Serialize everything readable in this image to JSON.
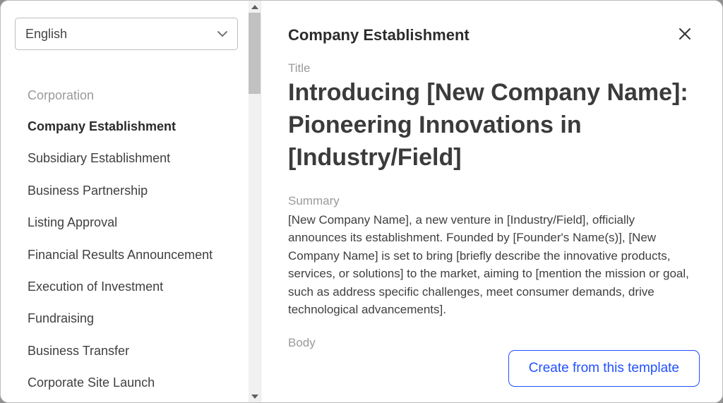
{
  "language": {
    "selected": "English"
  },
  "sidebar": {
    "category": "Corporation",
    "items": [
      {
        "label": "Company Establishment",
        "selected": true
      },
      {
        "label": "Subsidiary Establishment",
        "selected": false
      },
      {
        "label": "Business Partnership",
        "selected": false
      },
      {
        "label": "Listing Approval",
        "selected": false
      },
      {
        "label": "Financial Results Announcement",
        "selected": false
      },
      {
        "label": "Execution of Investment",
        "selected": false
      },
      {
        "label": "Fundraising",
        "selected": false
      },
      {
        "label": "Business Transfer",
        "selected": false
      },
      {
        "label": "Corporate Site Launch",
        "selected": false
      }
    ]
  },
  "main": {
    "heading": "Company Establishment",
    "title_label": "Title",
    "title_value": "Introducing [New Company Name]: Pioneering Innovations in [Industry/Field]",
    "summary_label": "Summary",
    "summary_value": "[New Company Name], a new venture in [Industry/Field], officially announces its establishment. Founded by [Founder's Name(s)], [New Company Name] is set to bring [briefly describe the innovative products, services, or solutions] to the market, aiming to [mention the mission or goal, such as address specific challenges, meet consumer demands, drive technological advancements].",
    "body_label": "Body",
    "create_button": "Create from this template"
  }
}
